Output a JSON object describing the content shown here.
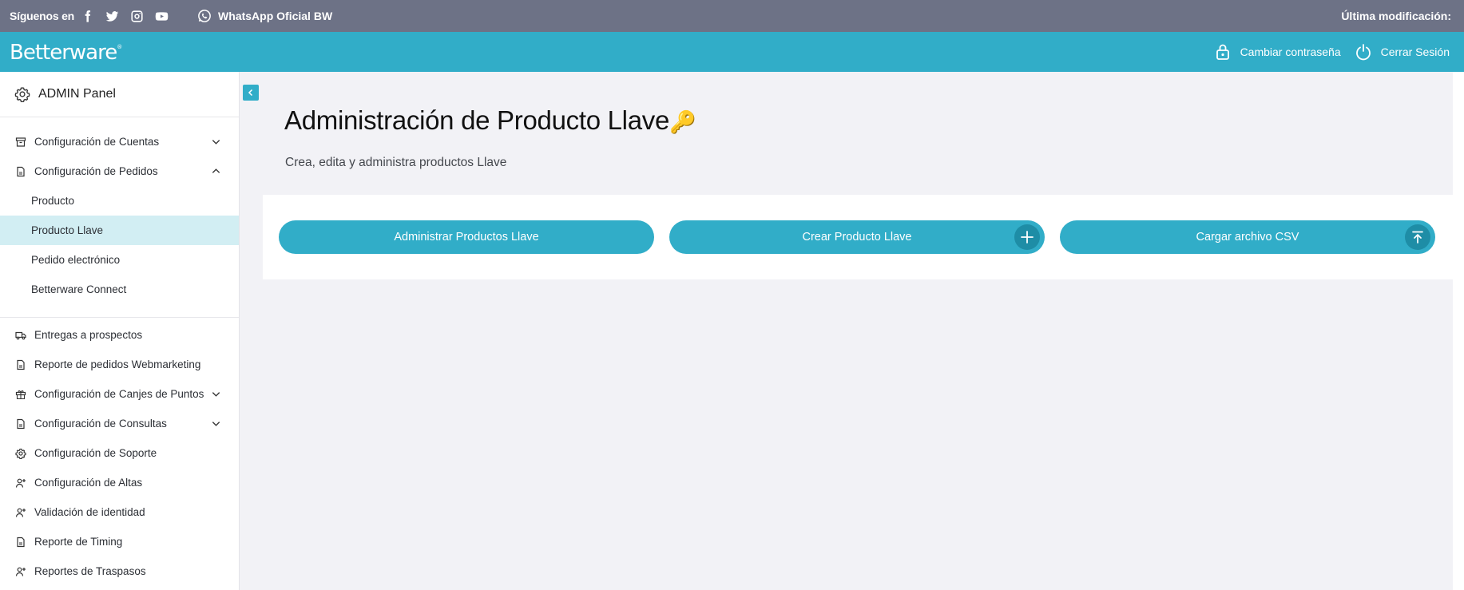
{
  "topbar": {
    "follow_label": "Síguenos en",
    "social_icons": [
      "facebook-icon",
      "twitter-icon",
      "instagram-icon",
      "youtube-icon"
    ],
    "whatsapp_label": "WhatsApp Oficial BW",
    "last_modified_label": "Última modificación:"
  },
  "header": {
    "logo_text": "Betterware",
    "change_password_label": "Cambiar contraseña",
    "logout_label": "Cerrar Sesión",
    "brand_color": "#31adc8"
  },
  "sidebar": {
    "panel_title": "ADMIN Panel",
    "groups": [
      {
        "label": "Configuración de Cuentas",
        "icon": "archive-icon",
        "expanded": false
      },
      {
        "label": "Configuración de Pedidos",
        "icon": "document-icon",
        "expanded": true
      }
    ],
    "subitems": [
      {
        "label": "Producto",
        "active": false
      },
      {
        "label": "Producto Llave",
        "active": true
      },
      {
        "label": "Pedido electrónico",
        "active": false
      },
      {
        "label": "Betterware Connect",
        "active": false
      }
    ],
    "items": [
      {
        "label": "Entregas a prospectos",
        "icon": "truck-icon"
      },
      {
        "label": "Reporte de pedidos Webmarketing",
        "icon": "document-icon"
      },
      {
        "label": "Configuración de Canjes de Puntos",
        "icon": "gift-icon",
        "expandable": true
      },
      {
        "label": "Configuración de Consultas",
        "icon": "document-icon",
        "expandable": true
      },
      {
        "label": "Configuración de Soporte",
        "icon": "gear-icon"
      },
      {
        "label": "Configuración de Altas",
        "icon": "user-add-icon"
      },
      {
        "label": "Validación de identidad",
        "icon": "user-add-icon"
      },
      {
        "label": "Reporte de Timing",
        "icon": "document-icon"
      },
      {
        "label": "Reportes de Traspasos",
        "icon": "user-add-icon"
      }
    ]
  },
  "main": {
    "title": "Administración de Producto Llave",
    "title_emoji": "🔑",
    "subtitle": "Crea, edita y administra productos Llave",
    "buttons": [
      {
        "label": "Administrar Productos Llave",
        "icon": null
      },
      {
        "label": "Crear Producto Llave",
        "icon": "plus-icon"
      },
      {
        "label": "Cargar archivo CSV",
        "icon": "upload-icon"
      }
    ]
  }
}
